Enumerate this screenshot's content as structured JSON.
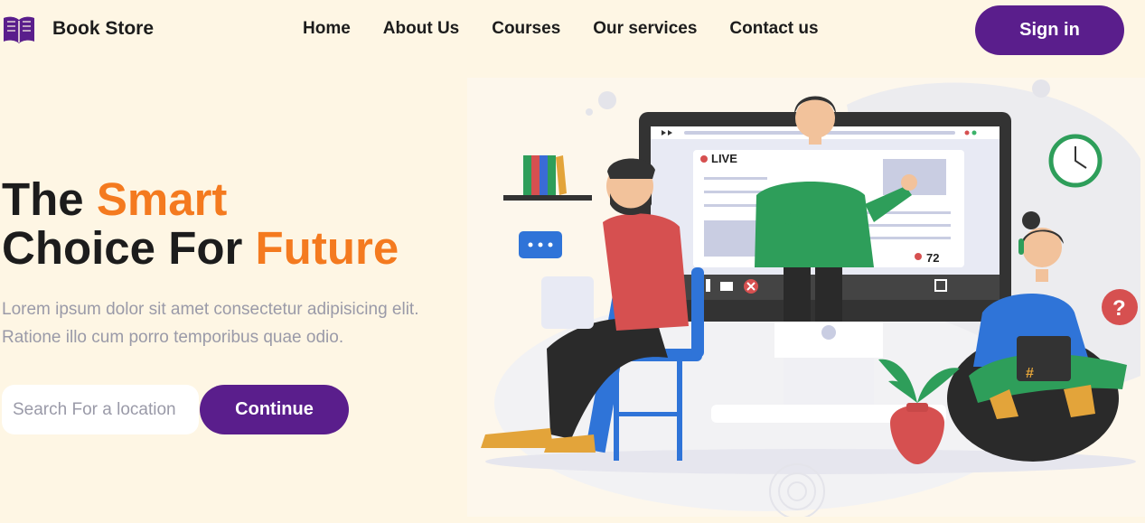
{
  "brand": {
    "name": "Book Store",
    "logo_icon": "open-book-icon"
  },
  "nav": {
    "items": [
      "Home",
      "About Us",
      "Courses",
      "Our services",
      "Contact us"
    ]
  },
  "signin_label": "Sign in",
  "hero": {
    "title_part1": "The ",
    "title_accent1": "Smart",
    "title_part2": "Choice For ",
    "title_accent2": "Future",
    "description_line1": "Lorem ipsum dolor sit amet consectetur adipisicing elit.",
    "description_line2": "Ratione illo cum porro temporibus quae odio."
  },
  "search": {
    "placeholder": "Search For a location",
    "value": ""
  },
  "continue_label": "Continue",
  "illustration": {
    "live_label": "LIVE",
    "viewer_count": "72"
  },
  "colors": {
    "primary": "#5a1e8c",
    "accent": "#f47a1f",
    "background": "#fef6e4",
    "muted_text": "#9a9aa8"
  }
}
